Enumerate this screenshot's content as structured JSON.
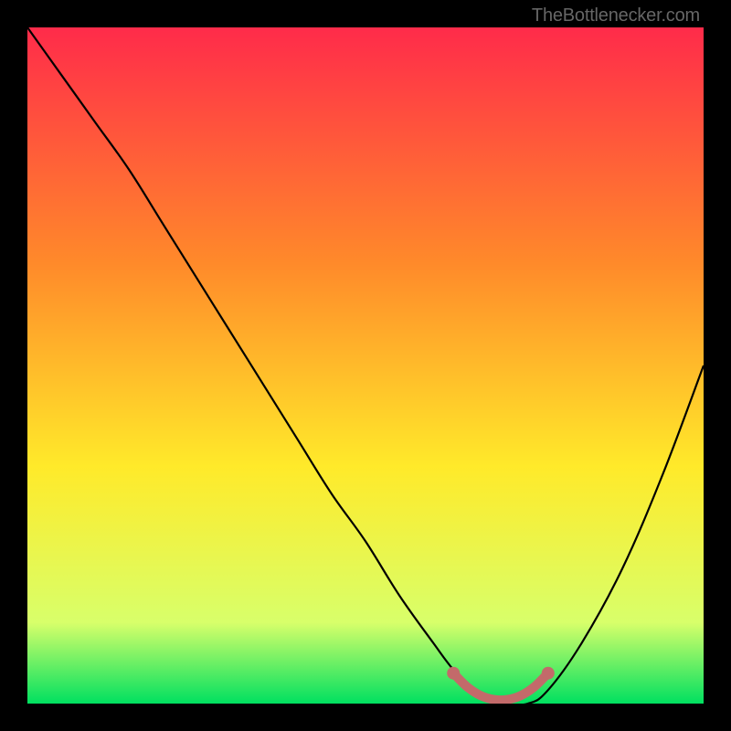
{
  "attribution": "TheBottlenecker.com",
  "chart_data": {
    "type": "line",
    "title": "",
    "xlabel": "",
    "ylabel": "",
    "xlim": [
      0,
      100
    ],
    "ylim": [
      0,
      100
    ],
    "background_gradient": {
      "top": "#ff2b4a",
      "upper_mid": "#ff8a2a",
      "mid": "#ffea2a",
      "lower": "#d8ff6a",
      "bottom": "#00e060"
    },
    "series": [
      {
        "name": "curve",
        "color": "#000000",
        "x": [
          0,
          5,
          10,
          15,
          20,
          25,
          30,
          35,
          40,
          45,
          50,
          55,
          60,
          63,
          66,
          70,
          74,
          77,
          82,
          88,
          94,
          100
        ],
        "y": [
          100,
          93,
          86,
          79,
          71,
          63,
          55,
          47,
          39,
          31,
          24,
          16,
          9,
          5,
          2,
          0,
          0,
          2,
          9,
          20,
          34,
          50
        ]
      },
      {
        "name": "flat-highlight",
        "color": "#c36a6a",
        "x": [
          63,
          65,
          67,
          69,
          71,
          73,
          75,
          77
        ],
        "y": [
          4.5,
          2.5,
          1.2,
          0.6,
          0.6,
          1.2,
          2.5,
          4.5
        ]
      }
    ],
    "highlight_endpoints": {
      "color": "#c36a6a",
      "points": [
        {
          "x": 63,
          "y": 4.5
        },
        {
          "x": 77,
          "y": 4.5
        }
      ]
    }
  }
}
